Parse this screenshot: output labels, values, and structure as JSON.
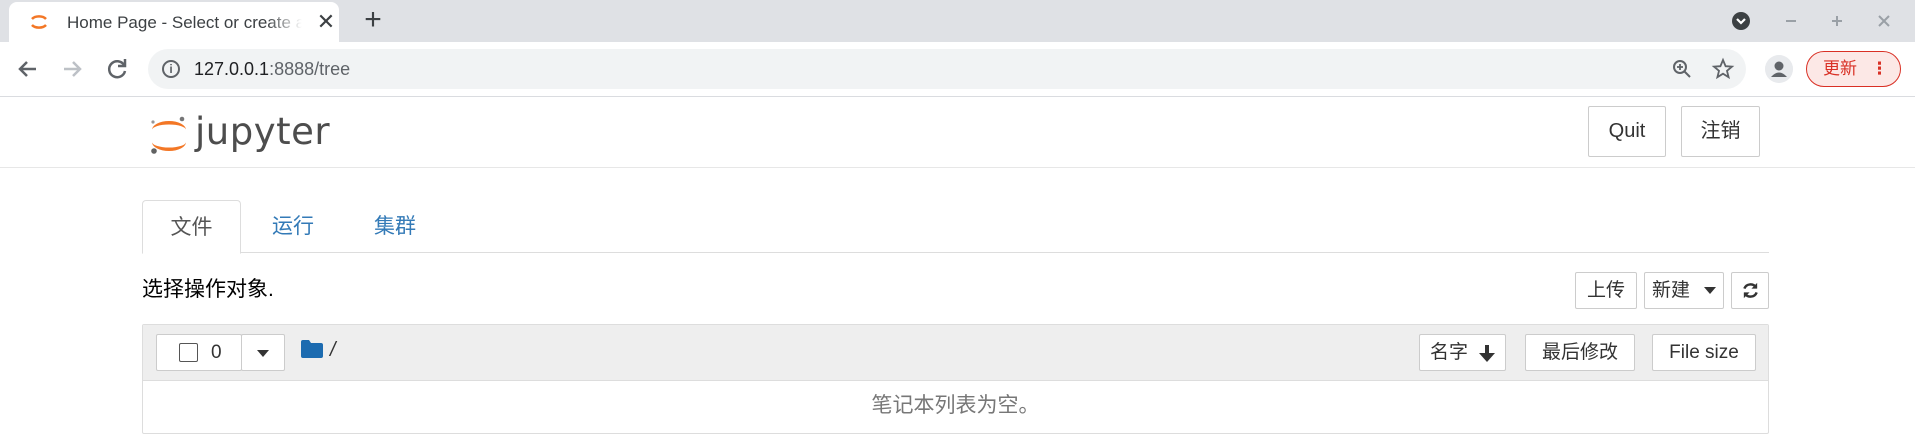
{
  "browser": {
    "tab_title": "Home Page - Select or create a notebook",
    "tab_close": "✕",
    "new_tab": "+",
    "url_host": "127.0.0.1",
    "url_rest": ":8888/tree",
    "update_label": "更新",
    "menu_dots": "⋮"
  },
  "header": {
    "logo_text": "jupyter",
    "quit_label": "Quit",
    "logout_label": "注销"
  },
  "tabs": [
    {
      "label": "文件",
      "active": true
    },
    {
      "label": "运行",
      "active": false
    },
    {
      "label": "集群",
      "active": false
    }
  ],
  "toolbar": {
    "select_text": "选择操作对象.",
    "upload_label": "上传",
    "new_label": "新建"
  },
  "list": {
    "selected_count": "0",
    "path": "/",
    "sort_name_label": "名字",
    "last_modified_label": "最后修改",
    "file_size_label": "File size",
    "empty_message": "笔记本列表为空。"
  },
  "colors": {
    "jupyter_orange": "#f37726",
    "link_blue": "#337ab7",
    "folder_blue": "#1c6bb0",
    "update_red": "#d93025"
  }
}
